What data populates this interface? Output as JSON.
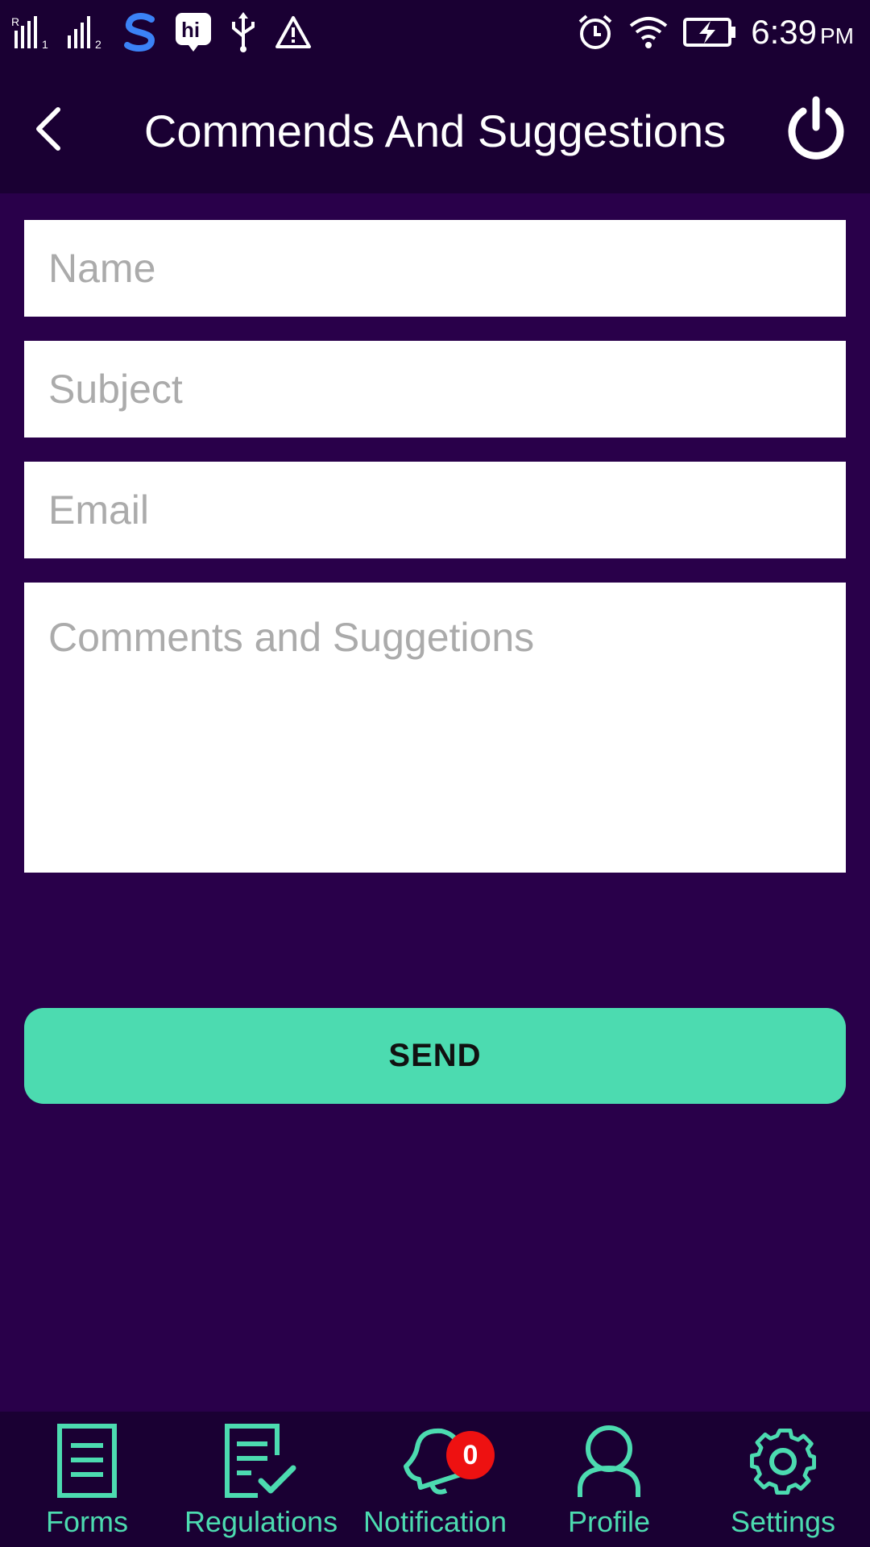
{
  "status_bar": {
    "time": "6:39",
    "ampm": "PM",
    "left_icons": [
      "signal-r-icon",
      "signal-2-icon",
      "s-app-icon",
      "hi-app-icon",
      "usb-icon",
      "warning-icon"
    ],
    "right_icons": [
      "alarm-icon",
      "wifi-icon",
      "battery-charging-icon"
    ]
  },
  "header": {
    "title": "Commends And Suggestions",
    "back_icon": "chevron-left-icon",
    "power_icon": "power-icon"
  },
  "form": {
    "name_placeholder": "Name",
    "subject_placeholder": "Subject",
    "email_placeholder": "Email",
    "comments_placeholder": "Comments and Suggetions",
    "name_value": "",
    "subject_value": "",
    "email_value": "",
    "comments_value": "",
    "send_label": "SEND"
  },
  "bottom_nav": {
    "forms": {
      "label": "Forms",
      "icon": "document-icon"
    },
    "regulations": {
      "label": "Regulations",
      "icon": "document-check-icon"
    },
    "notification": {
      "label": "Notification",
      "icon": "bell-icon",
      "badge": "0"
    },
    "profile": {
      "label": "Profile",
      "icon": "person-icon"
    },
    "settings": {
      "label": "Settings",
      "icon": "gear-icon"
    }
  },
  "colors": {
    "background": "#29004a",
    "bars": "#1a0033",
    "accent": "#4cdbb0",
    "badge": "#ee1111"
  }
}
